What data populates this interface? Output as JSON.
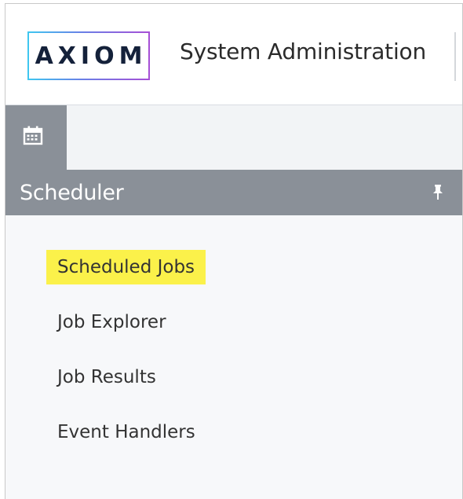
{
  "header": {
    "logo_text": "AXIOM",
    "title": "System Administration"
  },
  "toolbar": {
    "tabs": [
      {
        "icon": "calendar-icon",
        "selected": true
      }
    ]
  },
  "panel": {
    "title": "Scheduler",
    "pin_icon": "pin-icon",
    "items": [
      {
        "label": "Scheduled Jobs",
        "highlighted": true
      },
      {
        "label": "Job Explorer",
        "highlighted": false
      },
      {
        "label": "Job Results",
        "highlighted": false
      },
      {
        "label": "Event Handlers",
        "highlighted": false
      }
    ]
  },
  "colors": {
    "panel_header": "#8a9098",
    "highlight": "#fbf14a",
    "logo_gradient_start": "#3fc7f0",
    "logo_gradient_end": "#a64fd6"
  }
}
